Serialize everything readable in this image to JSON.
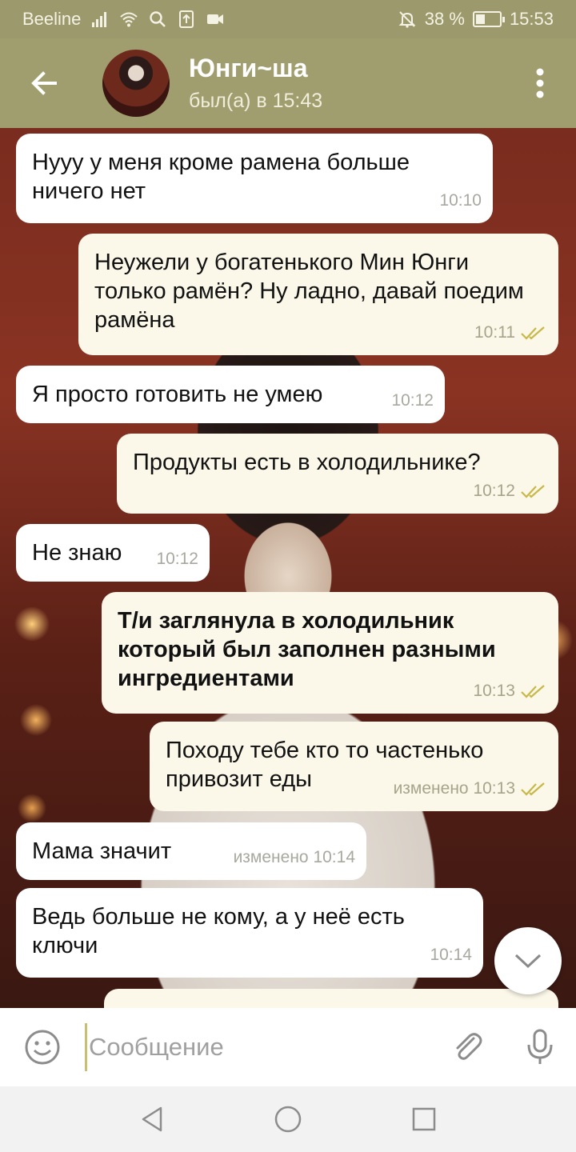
{
  "status_bar": {
    "carrier": "Beeline",
    "battery": "38 %",
    "battery_level": 0.38,
    "time": "15:53",
    "icons": [
      "signal-icon",
      "wifi-icon",
      "search-icon",
      "upload-icon",
      "video-icon",
      "mute-bell-icon",
      "battery-icon"
    ]
  },
  "header": {
    "back_icon": "arrow-left-icon",
    "contact_name": "Юнги~ша",
    "contact_status": "был(а) в 15:43",
    "menu_icon": "more-vertical-icon"
  },
  "messages": [
    {
      "direction": "in",
      "text": "Нууу у меня кроме рамена больше ничего нет",
      "time": "10:10"
    },
    {
      "direction": "out",
      "text": "Неужели у богатенького Мин Юнги только рамён? Ну ладно, давай поедим рамёна",
      "time": "10:11",
      "read": true
    },
    {
      "direction": "in",
      "text": "Я просто готовить не умею",
      "time": "10:12"
    },
    {
      "direction": "out",
      "text": "Продукты есть в холодильнике?",
      "time": "10:12",
      "read": true
    },
    {
      "direction": "in",
      "text": "Не знаю",
      "time": "10:12"
    },
    {
      "direction": "out",
      "text": "Т/и заглянула в холодильник который был заполнен разными ингредиентами",
      "time": "10:13",
      "read": true,
      "bold": true
    },
    {
      "direction": "out",
      "text": "Походу тебе кто то частенько привозит еды",
      "time": "изменено 10:13",
      "read": true
    },
    {
      "direction": "in",
      "text": "Мама значит",
      "time": "изменено 10:14"
    },
    {
      "direction": "in",
      "text": "Ведь больше не кому, а у неё есть ключи",
      "time": "10:14"
    }
  ],
  "composer": {
    "placeholder": "Сообщение",
    "emoji_icon": "emoji-smile-icon",
    "attach_icon": "paperclip-icon",
    "mic_icon": "microphone-icon"
  },
  "scroll_down_icon": "chevron-down-icon",
  "navbar": {
    "icons": [
      "back-triangle-icon",
      "home-circle-icon",
      "recents-square-icon"
    ]
  },
  "colors": {
    "header_bg": "#a09e6e",
    "status_bar_bg": "#9c9a6c",
    "incoming_bubble": "#ffffff",
    "outgoing_bubble": "#fbf8e9",
    "read_ticks": "#c8b84a"
  }
}
